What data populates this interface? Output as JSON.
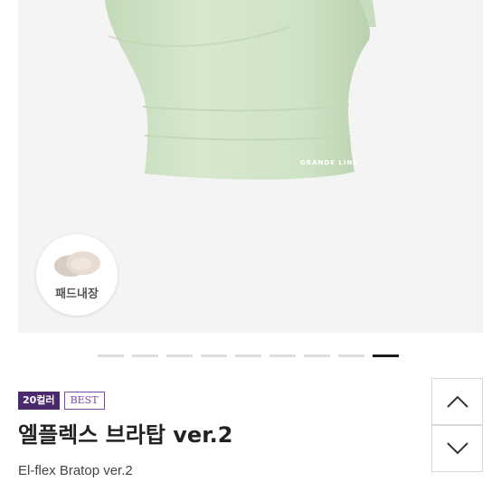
{
  "product": {
    "image_alt": "El-flex bratop mint",
    "brand_watermark": "GRANDE LINE",
    "pad_badge_label": "패드내장",
    "color_badge": "20컬러",
    "best_badge": "BEST",
    "title": "엘플렉스 브라탑 ver.2",
    "subtitle": "El-flex Bratop ver.2"
  },
  "carousel": {
    "total": 9,
    "active_index": 8
  },
  "scroll_buttons": {
    "up_icon": "chevron-up-icon",
    "down_icon": "chevron-down-icon"
  },
  "colors": {
    "garment": "#cfe3c6",
    "badge_purple": "#4a2a6c",
    "best_purple": "#7b4aa8"
  }
}
